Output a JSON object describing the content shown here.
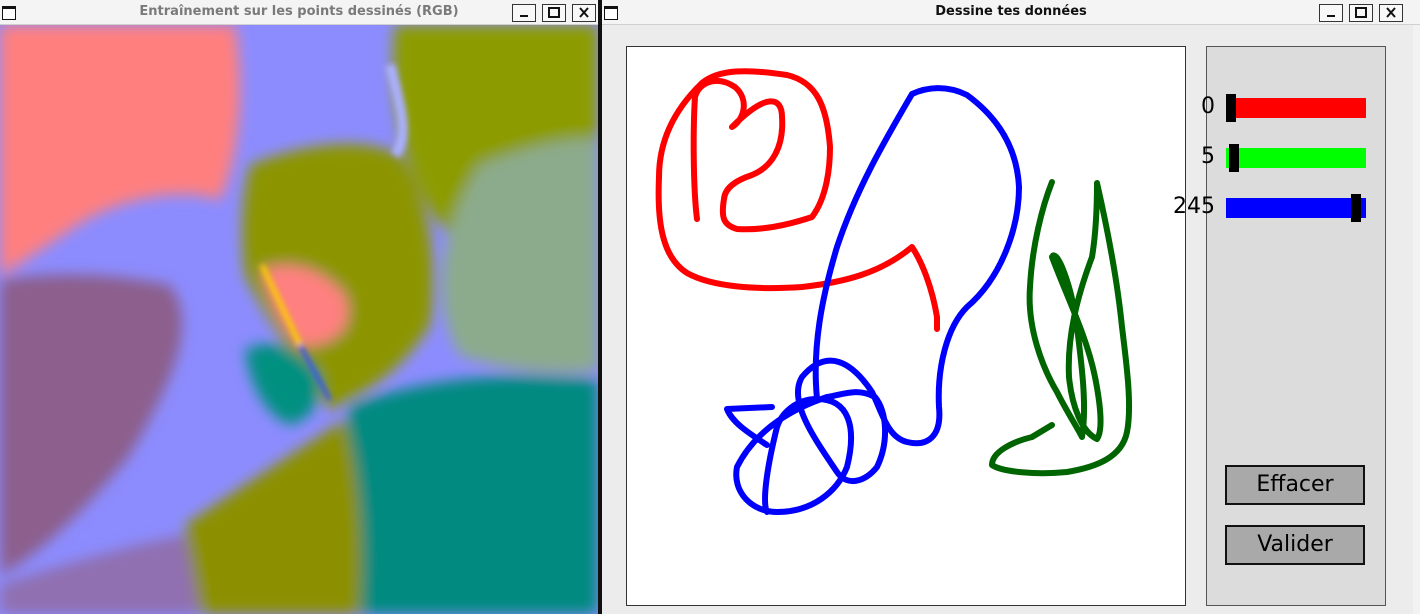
{
  "left_window": {
    "title": "Entraînement sur les points dessinés (RGB)"
  },
  "right_window": {
    "title": "Dessine tes données"
  },
  "controls": {
    "sliders": [
      {
        "name": "red",
        "value": "0",
        "level": 0.0,
        "color": "#ff0000"
      },
      {
        "name": "green",
        "value": "5",
        "level": 0.02,
        "color": "#00ff00"
      },
      {
        "name": "blue",
        "value": "245",
        "level": 0.96,
        "color": "#0000ff"
      }
    ],
    "clear_label": "Effacer",
    "validate_label": "Valider"
  },
  "colors": {
    "stroke_red": "#ff0000",
    "stroke_blue": "#0000ff",
    "stroke_green": "#006400",
    "bg_salmon": "#ff7f7f",
    "bg_periwinkle": "#8c8cff",
    "bg_olive": "#8c9900",
    "bg_teal": "#008080",
    "bg_mauve": "#8c5f8c"
  }
}
